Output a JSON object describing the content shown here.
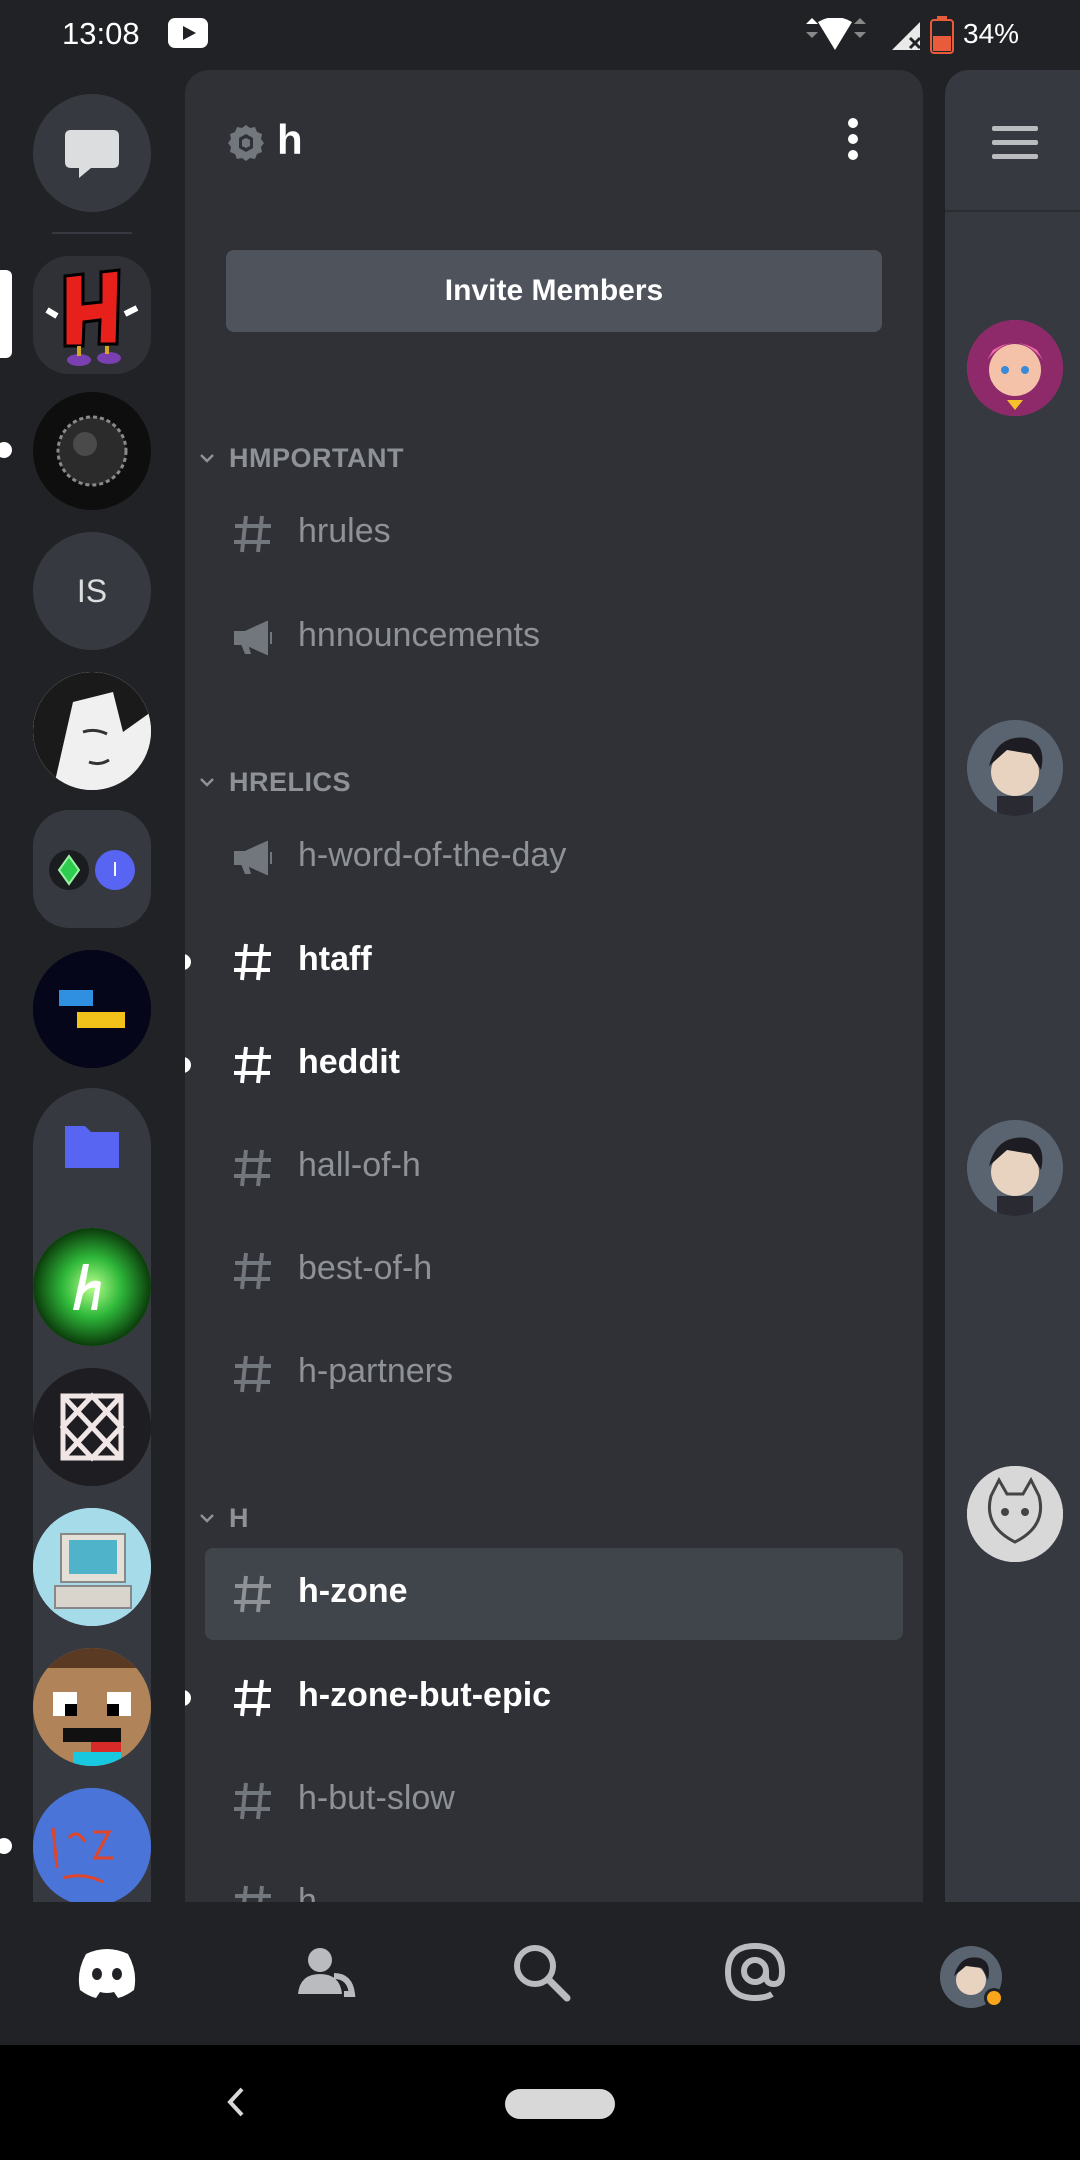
{
  "status_bar": {
    "time": "13:08",
    "battery": "34%"
  },
  "server_rail": {
    "items": [
      {
        "name": "direct-messages"
      },
      {
        "name": "server-h"
      },
      {
        "name": "server-dark-orb"
      },
      {
        "name": "server-is",
        "initials": "IS"
      },
      {
        "name": "server-manga"
      },
      {
        "name": "server-combo",
        "badge_letter": "I"
      },
      {
        "name": "server-sky-rel"
      },
      {
        "name": "server-folder"
      },
      {
        "name": "server-green-h"
      },
      {
        "name": "server-geometric"
      },
      {
        "name": "server-computer"
      },
      {
        "name": "server-pixel-face"
      },
      {
        "name": "server-blue-writing"
      }
    ]
  },
  "server": {
    "name": "h",
    "invite_label": "Invite Members"
  },
  "categories": [
    {
      "label": "HMPORTANT"
    },
    {
      "label": "HRELICS"
    },
    {
      "label": "H"
    }
  ],
  "channels": [
    {
      "name": "hrules",
      "type": "text",
      "state": "normal"
    },
    {
      "name": "hnnouncements",
      "type": "announcement",
      "state": "normal"
    },
    {
      "name": "h-word-of-the-day",
      "type": "announcement",
      "state": "normal"
    },
    {
      "name": "htaff",
      "type": "text",
      "state": "unread"
    },
    {
      "name": "heddit",
      "type": "text",
      "state": "unread"
    },
    {
      "name": "hall-of-h",
      "type": "text",
      "state": "normal"
    },
    {
      "name": "best-of-h",
      "type": "text",
      "state": "normal"
    },
    {
      "name": "h-partners",
      "type": "text",
      "state": "normal"
    },
    {
      "name": "h-zone",
      "type": "text",
      "state": "selected"
    },
    {
      "name": "h-zone-but-epic",
      "type": "text",
      "state": "unread"
    },
    {
      "name": "h-but-slow",
      "type": "text",
      "state": "normal"
    },
    {
      "name": "h",
      "type": "text",
      "state": "normal"
    }
  ],
  "bottom_nav": {
    "items": [
      "home-icon",
      "friends-icon",
      "search-icon",
      "mentions-icon",
      "profile-avatar"
    ]
  },
  "colors": {
    "background": "#202225",
    "channel_panel": "#2f3136",
    "member_panel": "#36393f",
    "selected_channel": "#40444b",
    "muted_text": "#8e9297",
    "blurple": "#5865f2",
    "idle_status": "#faa61a"
  }
}
